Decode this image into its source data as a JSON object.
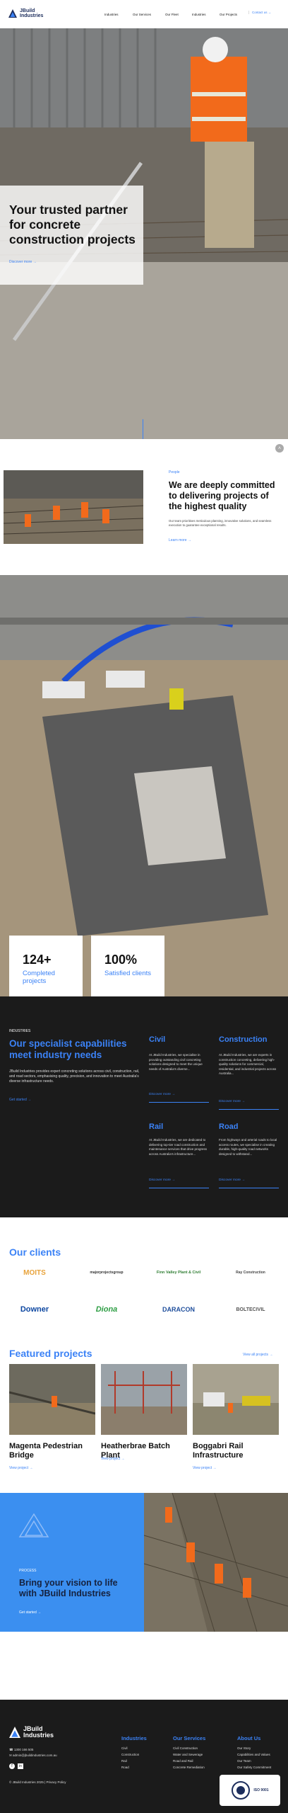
{
  "header": {
    "logo": {
      "name_line1": "JBuild",
      "name_line2": "Industries"
    },
    "nav": [
      "Industries",
      "Our Services",
      "Our Fleet",
      "Industries",
      "Our Projects"
    ],
    "contact_label": "Contact us"
  },
  "hero": {
    "title": "Your trusted partner for concrete construction projects",
    "link": "Discover more"
  },
  "about": {
    "label": "People",
    "title": "We are deeply committed to delivering projects of the highest quality",
    "body": "Our team prioritises meticulous planning, innovative solutions, and seamless execution to guarantee exceptional results.",
    "link": "Learn more"
  },
  "stats": [
    {
      "value": "124+",
      "label": "Completed projects"
    },
    {
      "value": "100%",
      "label": "Satisfied clients"
    }
  ],
  "services": {
    "kicker": "INDUSTRIES",
    "title": "Our specialist capabilities meet industry needs",
    "body": "JBuild Industries provides expert concreting solutions across civil, construction, rail, and road sectors, emphasising quality, precision, and innovation to meet Australia's diverse infrastructure needs.",
    "link": "Get started",
    "cards": [
      {
        "title": "Civil",
        "body": "At JBuild Industries, we specialise in providing outstanding civil concreting solutions designed to meet the unique needs of Australia's diverse...",
        "link": "Discover more"
      },
      {
        "title": "Construction",
        "body": "At JBuild Industries, we are experts in construction concreting, delivering high-quality solutions for commercial, residential, and industrial projects across Australia...",
        "link": "Discover more"
      },
      {
        "title": "Rail",
        "body": "At JBuild Industries, we are dedicated to delivering top-tier road construction and maintenance services that drive progress across Australia's infrastructure...",
        "link": "Discover more"
      },
      {
        "title": "Road",
        "body": "From highways and arterial roads to local access routes, we specialise in creating durable, high-quality road networks designed to withstand...",
        "link": "Discover more"
      }
    ]
  },
  "clients": {
    "title": "Our clients",
    "logos": [
      {
        "name": "MOITS",
        "color": "#e8a33b"
      },
      {
        "name": "majorprojectsgroup",
        "color": "#333333"
      },
      {
        "name": "Finn Valley Plant & Civil",
        "color": "#2e7d32"
      },
      {
        "name": "Ray Construction",
        "color": "#444444"
      },
      {
        "name": "Downer",
        "color": "#0d47a1"
      },
      {
        "name": "Diona",
        "color": "#2e9e44"
      },
      {
        "name": "DARACON",
        "color": "#1f4e9c"
      },
      {
        "name": "BOLTECIVIL",
        "color": "#555555"
      }
    ]
  },
  "featured": {
    "title": "Featured projects",
    "all_link": "View all projects",
    "projects": [
      {
        "name": "Magenta Pedestrian Bridge",
        "link": "View project"
      },
      {
        "name": "Heatherbrae Batch Plant",
        "link": "View project"
      },
      {
        "name": "Boggabri Rail Infrastructure",
        "link": "View project"
      }
    ]
  },
  "process": {
    "kicker": "PROCESS",
    "title": "Bring your vision to life with JBuild Industries",
    "link": "Get started"
  },
  "footer": {
    "logo": {
      "name_line1": "JBuild",
      "name_line2": "Industries"
    },
    "phone": "1300 166 505",
    "email": "admin@jbuildindustries.com.au",
    "columns": [
      {
        "title": "Industries",
        "items": [
          "Civil",
          "Construction",
          "Rail",
          "Road"
        ]
      },
      {
        "title": "Our Services",
        "items": [
          "Civil Construction",
          "Water and Sewerage",
          "Road and Rail",
          "Concrete Remediation"
        ]
      },
      {
        "title": "About Us",
        "items": [
          "Our Story",
          "Capabilities and Values",
          "Our Team",
          "Our Safety Commitment"
        ]
      }
    ],
    "copyright": "© JBuild Industries 2025 | Privacy Policy",
    "cert_label": "ISO 9001"
  },
  "colors": {
    "accent": "#3b82f6",
    "dark": "#1b1b1b",
    "navy": "#1c2d5c"
  }
}
